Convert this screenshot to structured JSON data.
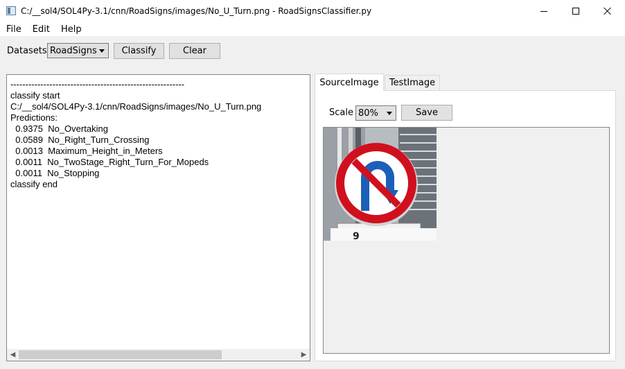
{
  "window": {
    "title": "C:/__sol4/SOL4Py-3.1/cnn/RoadSigns/images/No_U_Turn.png - RoadSignsClassifier.py"
  },
  "menu": [
    "File",
    "Edit",
    "Help"
  ],
  "toolbar": {
    "datasets_label": "Datasets",
    "datasets_value": "RoadSigns",
    "classify_label": "Classify",
    "clear_label": "Clear"
  },
  "log": {
    "lines": [
      "----------------------------------------------------------",
      "classify start",
      "C:/__sol4/SOL4Py-3.1/cnn/RoadSigns/images/No_U_Turn.png",
      "Predictions:",
      "  0.9375  No_Overtaking",
      "  0.0589  No_Right_Turn_Crossing",
      "  0.0013  Maximum_Height_in_Meters",
      "  0.0011  No_TwoStage_Right_Turn_For_Mopeds",
      "  0.0011  No_Stopping",
      "classify end"
    ]
  },
  "tabs": [
    {
      "label": "SourceImage",
      "active": true
    },
    {
      "label": "TestImage",
      "active": false
    }
  ],
  "viewer": {
    "scale_label": "Scale",
    "scale_value": "80%",
    "save_label": "Save"
  },
  "colors": {
    "sign_red": "#d0101e",
    "sign_blue": "#1c5fb8",
    "window_bg": "#f0f0f0"
  }
}
